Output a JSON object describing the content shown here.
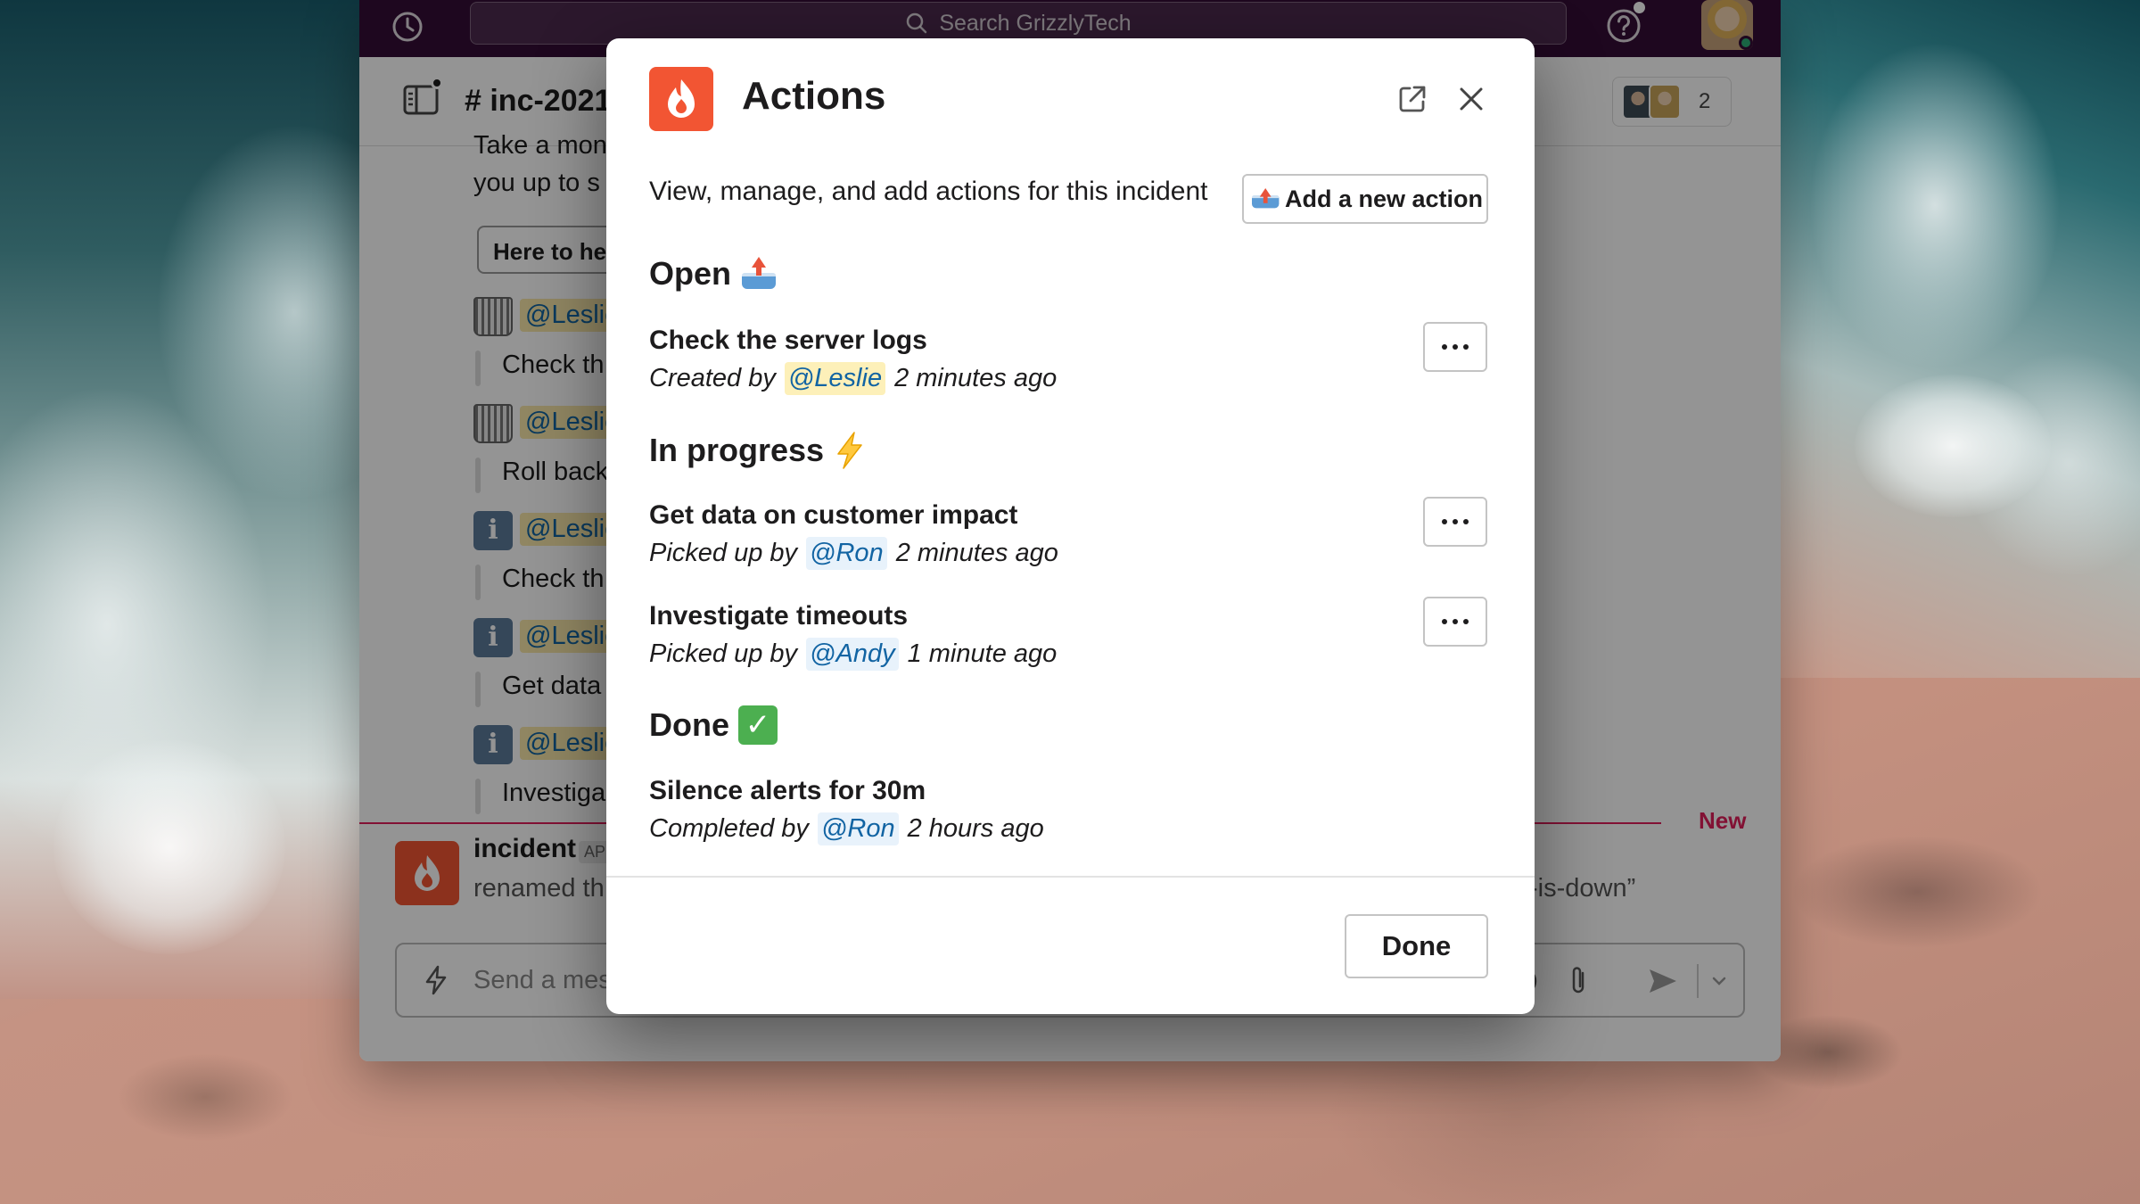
{
  "topbar": {
    "search_placeholder": "Search GrizzlyTech"
  },
  "channel": {
    "name": "# inc-2021",
    "member_count": "2"
  },
  "chat": {
    "intro_line_1": "Take a mon",
    "intro_line_2": "you up to s",
    "here_button": "Here to hel",
    "actions": [
      {
        "icon": "wastebasket-icon",
        "mention": "@Leslie",
        "text": "Check th"
      },
      {
        "icon": "wastebasket-icon",
        "mention": "@Leslie",
        "text": "Roll back"
      },
      {
        "icon": "info-icon",
        "mention": "@Leslie",
        "text": "Check th"
      },
      {
        "icon": "info-icon",
        "mention": "@Leslie",
        "text": "Get data"
      },
      {
        "icon": "info-icon",
        "mention": "@Leslie",
        "text": "Investiga"
      }
    ],
    "new_divider_label": "New",
    "bot": {
      "name": "incident",
      "tag": "AP",
      "text_left": "renamed th",
      "text_right": "-is-down”"
    },
    "composer_placeholder": "Send a mes"
  },
  "modal": {
    "title": "Actions",
    "description": "View, manage, and add actions for this incident",
    "add_button": "Add a new action",
    "sections": [
      {
        "heading": "Open",
        "emoji": "inbox-tray-icon",
        "items": [
          {
            "title": "Check the server logs",
            "verb": "Created by",
            "mention": "@Leslie",
            "when": "2 minutes ago"
          }
        ]
      },
      {
        "heading": "In progress",
        "emoji": "high-voltage-icon",
        "items": [
          {
            "title": "Get data on customer impact",
            "verb": "Picked up by",
            "mention": "@Ron",
            "when": "2 minutes ago"
          },
          {
            "title": "Investigate timeouts",
            "verb": "Picked up by",
            "mention": "@Andy",
            "when": "1 minute ago"
          }
        ]
      },
      {
        "heading": "Done",
        "emoji": "check-mark-button-icon",
        "items": [
          {
            "title": "Silence alerts for 30m",
            "verb": "Completed by",
            "mention": "@Ron",
            "when": "2 hours ago"
          }
        ]
      }
    ],
    "done_button": "Done"
  },
  "colors": {
    "accent": "#f25533",
    "mention": "#1264a3",
    "new_divider": "#e01e5a",
    "topbar": "#350d36"
  }
}
